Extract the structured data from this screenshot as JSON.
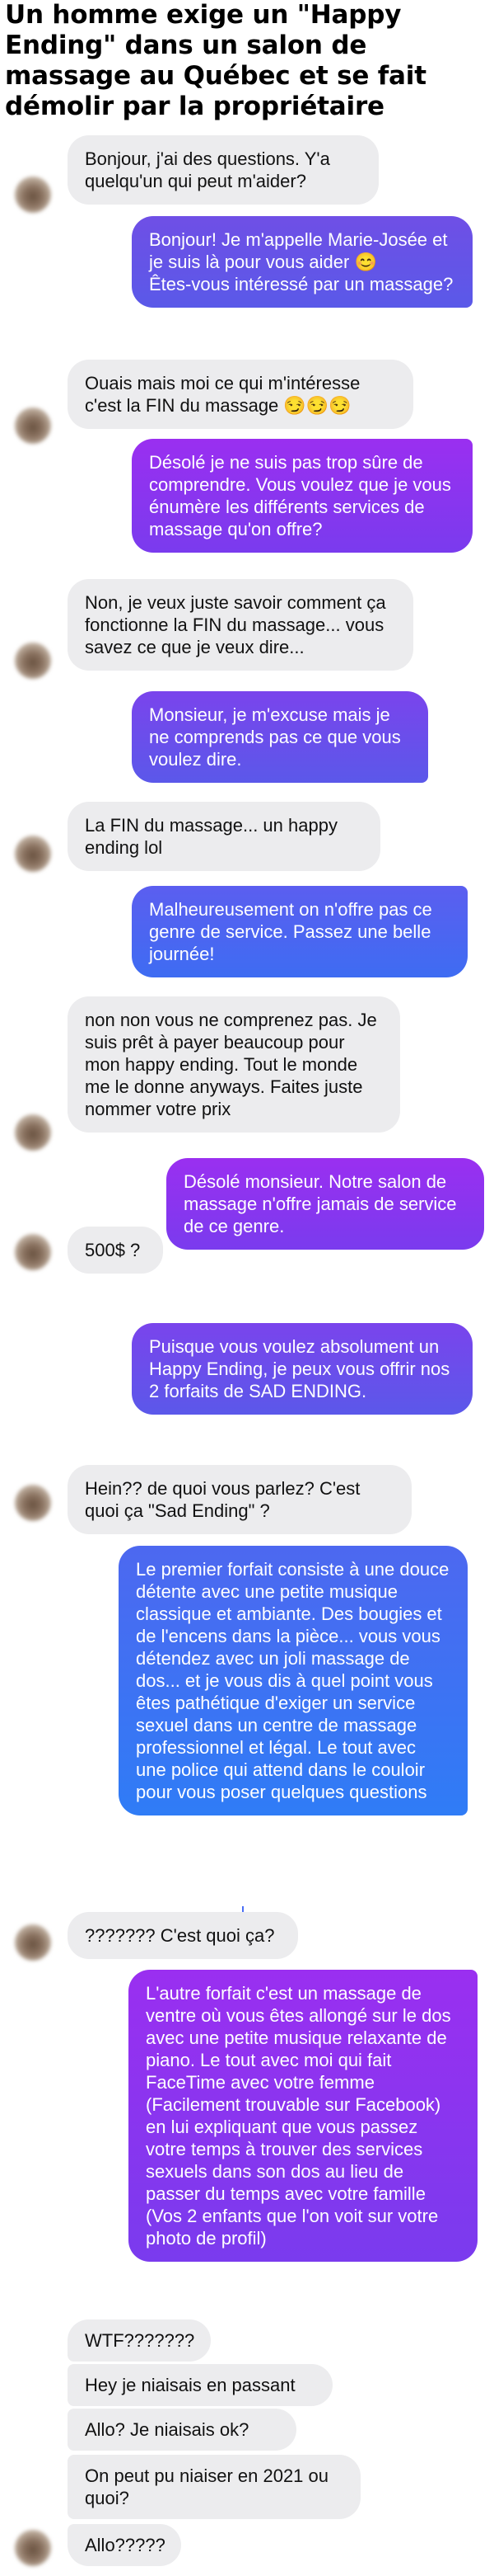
{
  "title": "Un homme exige un \"Happy Ending\" dans un salon de massage au Québec et se fait démolir par la propriétaire",
  "messages": [
    {
      "from": "customer",
      "text": "Bonjour, j'ai des questions. Y'a quelqu'un qui peut m'aider?"
    },
    {
      "from": "owner",
      "text": "Bonjour! Je m'appelle Marie-Josée et je suis là pour vous aider 😊\nÊtes-vous intéressé par un massage?"
    },
    {
      "from": "customer",
      "text": "Ouais mais moi ce qui m'intéresse c'est la FIN du massage 😏😏😏"
    },
    {
      "from": "owner",
      "text": "Désolé je ne suis pas trop sûre de comprendre. Vous voulez que je vous énumère les différents services de massage qu'on offre?"
    },
    {
      "from": "customer",
      "text": "Non, je veux juste savoir comment ça fonctionne la FIN du massage... vous savez ce que je veux dire..."
    },
    {
      "from": "owner",
      "text": "Monsieur, je m'excuse mais je ne comprends pas ce que vous voulez dire."
    },
    {
      "from": "customer",
      "text": "La FIN du massage... un happy ending lol"
    },
    {
      "from": "owner",
      "text": "Malheureusement on n'offre pas ce genre de service. Passez une belle journée!"
    },
    {
      "from": "customer",
      "text": "non non vous ne comprenez pas. Je suis prêt à payer beaucoup pour mon happy ending. Tout le monde me le donne anyways. Faites juste nommer votre prix"
    },
    {
      "from": "owner",
      "text": "Désolé monsieur. Notre salon de massage n'offre jamais de service de ce genre."
    },
    {
      "from": "customer",
      "text": "500$ ?"
    },
    {
      "from": "owner",
      "text": "Puisque vous voulez absolument un Happy Ending, je peux vous offrir nos 2 forfaits de SAD ENDING."
    },
    {
      "from": "customer",
      "text": "Hein?? de quoi vous parlez? C'est quoi ça \"Sad Ending\" ?"
    },
    {
      "from": "owner",
      "text": "Le premier forfait consiste à une douce détente avec une petite musique classique et ambiante. Des bougies et de l'encens dans la pièce... vous vous détendez avec un joli massage de dos... et je vous dis à quel point vous êtes pathétique d'exiger un service sexuel dans un centre de massage professionnel et légal. Le tout avec une police qui attend dans le couloir pour vous poser quelques questions"
    },
    {
      "from": "customer",
      "text": "??????? C'est quoi ça?"
    },
    {
      "from": "owner",
      "text": "L'autre forfait c'est un massage de ventre où vous êtes allongé sur le dos avec une petite musique relaxante de piano. Le tout avec moi qui fait FaceTime avec votre femme (Facilement trouvable sur Facebook) en lui expliquant que vous passez votre temps à trouver des services sexuels dans son dos au lieu de passer du temps avec votre famille (Vos 2 enfants que l'on voit sur votre photo de profil)"
    },
    {
      "from": "customer",
      "text": "WTF???????"
    },
    {
      "from": "customer",
      "text": "Hey je niaisais en passant"
    },
    {
      "from": "customer",
      "text": "Allo? Je niaisais ok?"
    },
    {
      "from": "customer",
      "text": "On peut pu niaiser en 2021 ou quoi?"
    },
    {
      "from": "customer",
      "text": "Allo?????"
    }
  ]
}
